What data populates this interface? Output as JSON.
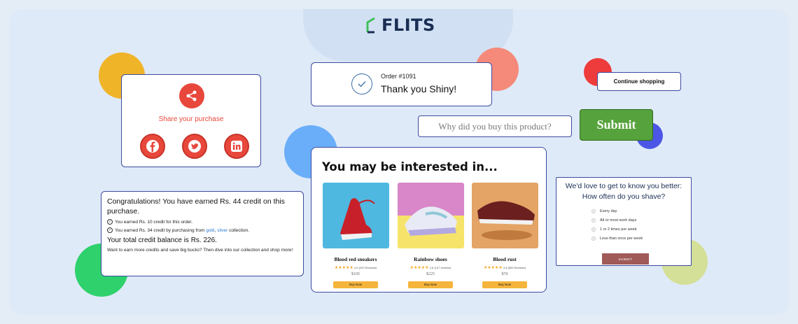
{
  "brand": {
    "name": "FLITS"
  },
  "share": {
    "title": "Share your purchase",
    "icons": [
      "share-icon",
      "facebook-icon",
      "twitter-icon",
      "linkedin-icon"
    ],
    "accent": "#e8473c"
  },
  "order": {
    "number": "Order #1091",
    "message": "Thank you Shiny!"
  },
  "continue_button": {
    "label": "Continue shopping"
  },
  "why_input": {
    "placeholder": "Why did you buy this product?"
  },
  "submit_button": {
    "label": "Submit",
    "color": "#56a23c"
  },
  "credit": {
    "title": "Congratulations! You have earned Rs. 44 credit on this purchase.",
    "line1": "You earned Rs. 10 credit for this order.",
    "line2_prefix": "You earned Rs. 34 credit by purchasing from",
    "link_gold": "gold",
    "comma": ",",
    "link_silver": "silver",
    "line2_suffix": "collection.",
    "total": "Your total credit balance is Rs. 226.",
    "footer": "Want to earn more credits and save big bucks? Then dive into our collection and shop more!"
  },
  "products": {
    "title": "You may be interested in...",
    "items": [
      {
        "name": "Blood red sneakers",
        "rating": "4.5 (220 Reviews)",
        "price": "$105",
        "button": "Buy Now"
      },
      {
        "name": "Rainbow shoes",
        "rating": "4.8 (137 reviews)",
        "price": "$225",
        "button": "Buy Now"
      },
      {
        "name": "Blood rust",
        "rating": "4.8 (800 Reviews)",
        "price": "$70",
        "button": "Buy Now"
      }
    ]
  },
  "survey": {
    "question_line1": "We'd love to get to know you better:",
    "question_line2": "How often do you shave?",
    "options": [
      "Every day",
      "All or most work days",
      "1 or 2 times per week",
      "Less than once per week"
    ],
    "submit": "SUBMIT"
  }
}
